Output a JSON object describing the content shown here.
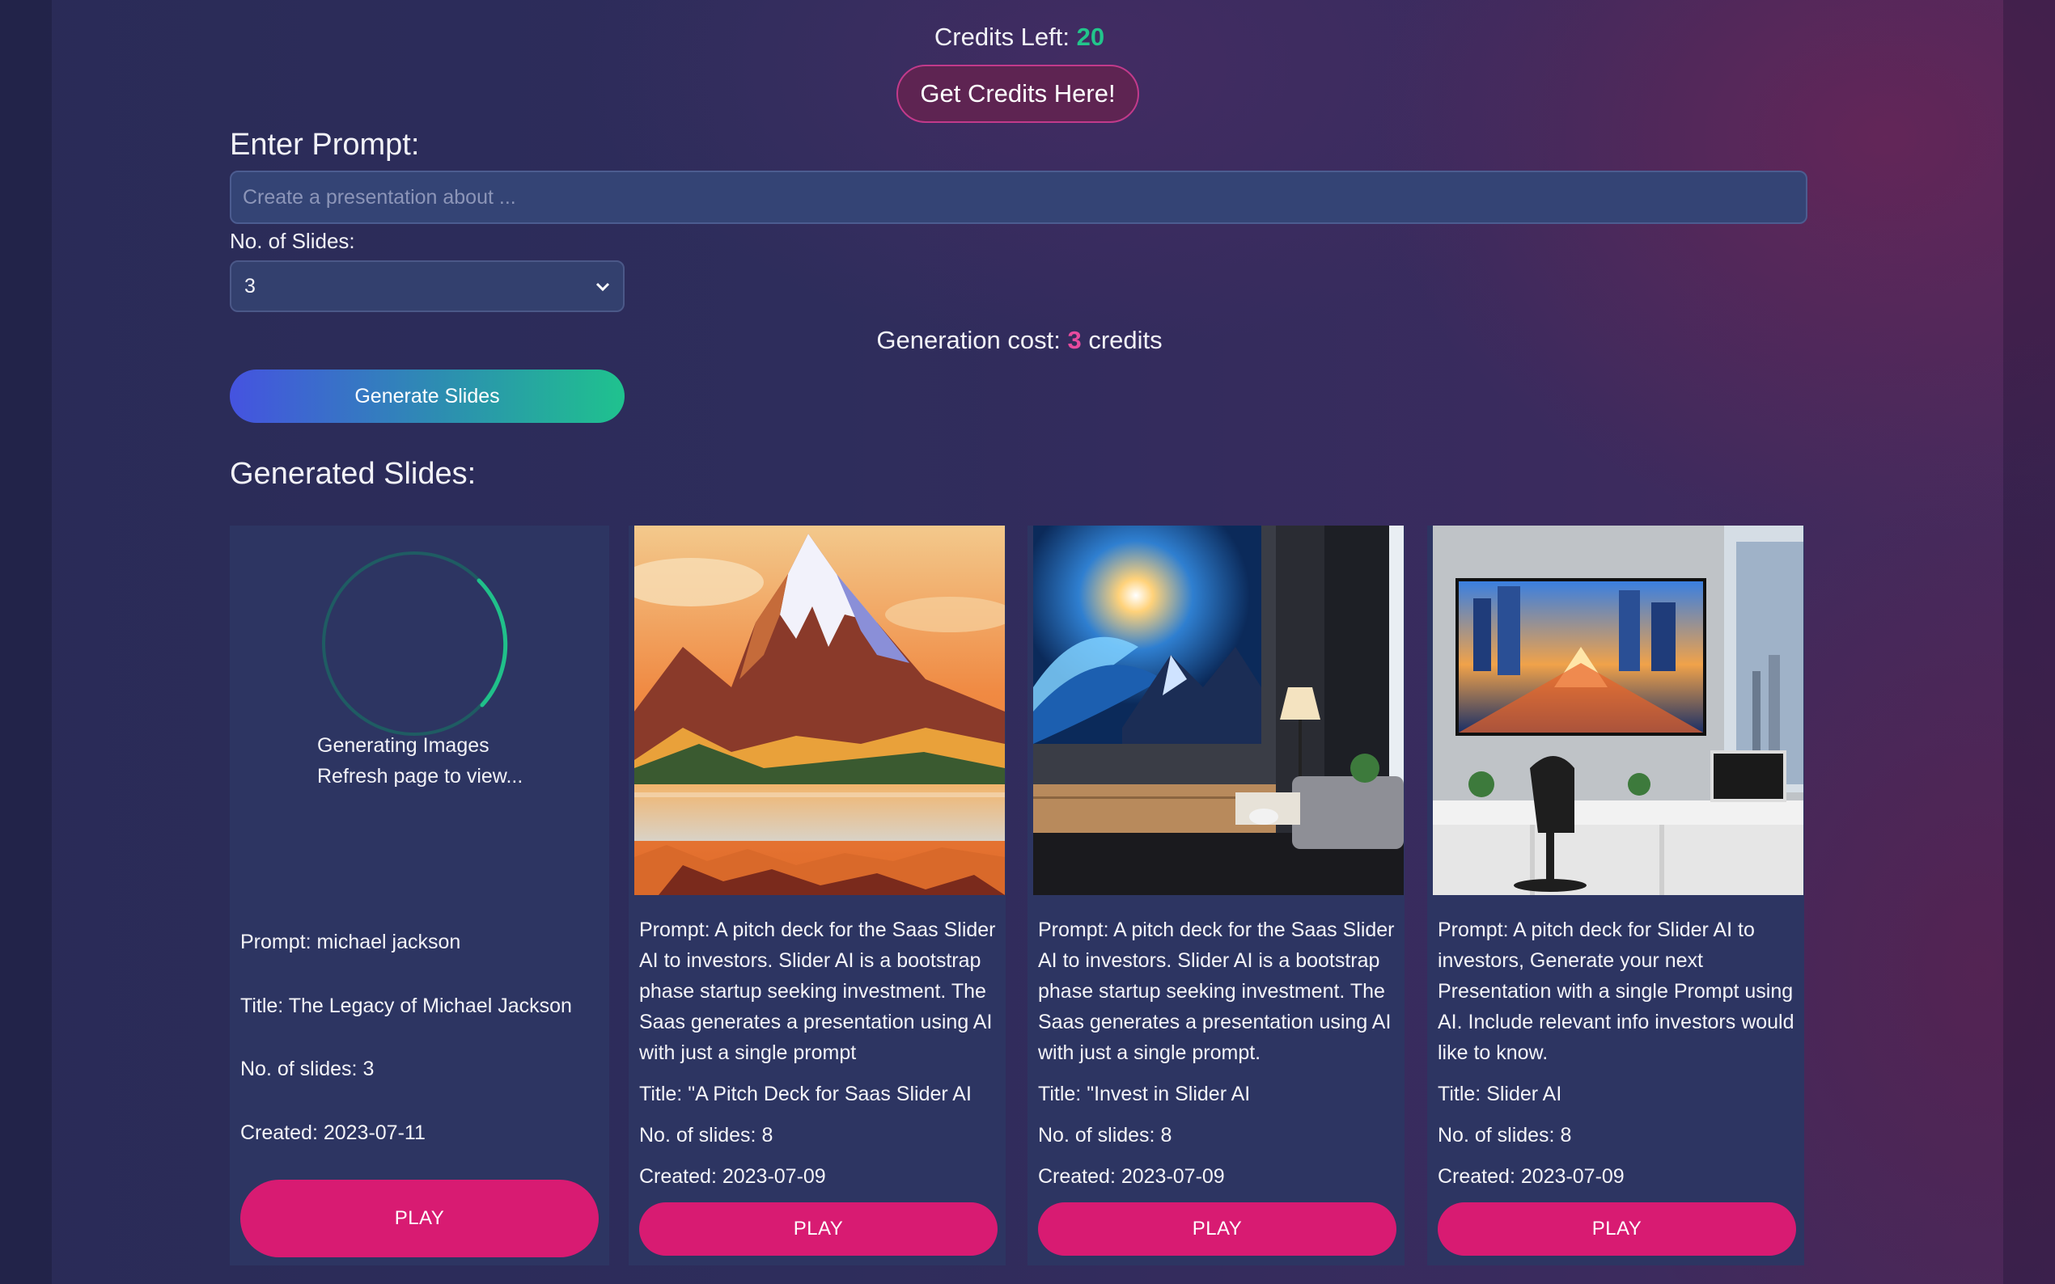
{
  "header": {
    "credits_label": "Credits Left:",
    "credits_value": "20",
    "get_credits_label": "Get Credits Here!"
  },
  "form": {
    "prompt_label": "Enter Prompt:",
    "prompt_value": "",
    "prompt_placeholder": "Create a presentation about ...",
    "slides_label": "No. of Slides:",
    "slides_selected": "3",
    "cost_prefix": "Generation cost:",
    "cost_value": "3",
    "cost_suffix": "credits",
    "generate_label": "Generate Slides"
  },
  "results": {
    "heading": "Generated Slides:",
    "cards": [
      {
        "status_line1": "Generating Images",
        "status_line2": "Refresh page to view...",
        "prompt": "Prompt: michael jackson",
        "title": "Title: The Legacy of Michael Jackson",
        "slides": "No. of slides: 3",
        "created": "Created: 2023-07-11",
        "play_label": "PLAY"
      },
      {
        "image": "mountain-lake-illustration",
        "prompt": "Prompt: A pitch deck for the Saas Slider AI to investors. Slider AI is a bootstrap phase startup seeking investment. The Saas generates a presentation using AI with just a single prompt",
        "title": "Title: \"A Pitch Deck for Saas Slider AI",
        "slides": "No. of slides: 8",
        "created": "Created: 2023-07-09",
        "play_label": "PLAY"
      },
      {
        "image": "living-room-wall-screen",
        "prompt": "Prompt: A pitch deck for the Saas Slider AI to investors. Slider AI is a bootstrap phase startup seeking investment. The Saas generates a presentation using AI with just a single prompt.",
        "title": "Title: \"Invest in Slider AI",
        "slides": "No. of slides: 8",
        "created": "Created: 2023-07-09",
        "play_label": "PLAY"
      },
      {
        "image": "office-wall-screen-city",
        "prompt": "Prompt: A pitch deck for Slider AI to investors, Generate your next Presentation with a single Prompt using AI. Include relevant info investors would like to know.",
        "title": "Title: Slider AI",
        "slides": "No. of slides: 8",
        "created": "Created: 2023-07-09",
        "play_label": "PLAY"
      }
    ]
  },
  "colors": {
    "accent_green": "#22c58b",
    "accent_pink": "#e74a9e",
    "play_button": "#d81b72"
  }
}
